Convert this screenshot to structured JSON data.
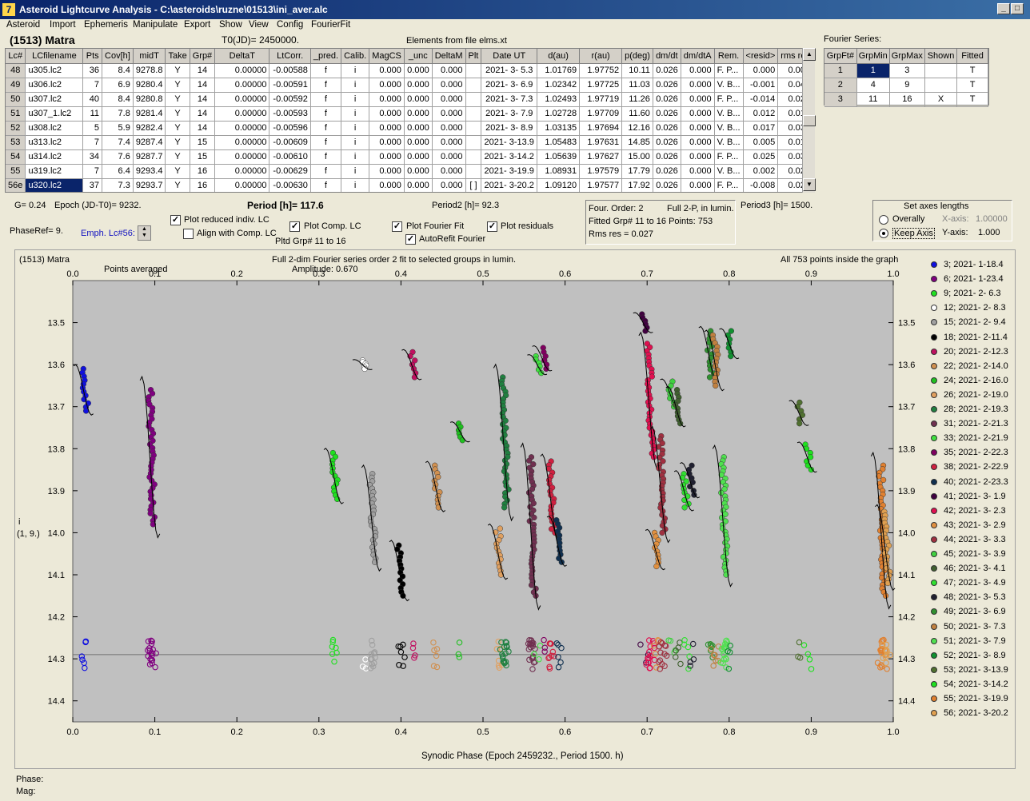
{
  "window": {
    "title": "Asteroid Lightcurve Analysis - C:\\asteroids\\ruzne\\01513\\ini_aver.alc"
  },
  "menu": [
    {
      "label": "Asteroid",
      "u": "A"
    },
    {
      "label": "Import",
      "u": "I"
    },
    {
      "label": "Ephemeris",
      "u": "E"
    },
    {
      "label": "Manipulate",
      "u": "M"
    },
    {
      "label": "Export",
      "u": "E"
    },
    {
      "label": "Show",
      "u": "S"
    },
    {
      "label": "View",
      "u": "V"
    },
    {
      "label": "Config",
      "u": "C"
    },
    {
      "label": "FourierFit",
      "u": "F"
    }
  ],
  "header": {
    "asteroid": "(1513) Matra",
    "t0": "T0(JD)= 2450000.",
    "elements": "Elements from file elms.xt"
  },
  "table": {
    "columns": [
      "Lc#",
      "LCfilename",
      "Pts",
      "Cov[h]",
      "midT",
      "Take",
      "Grp#",
      "DeltaT",
      "LtCorr.",
      "_pred.",
      "Calib.",
      "MagCS",
      "_unc",
      "DeltaM",
      "Plt",
      "Date UT",
      "d(au)",
      "r(au)",
      "p(deg)",
      "dm/dt",
      "dm/dtA",
      "Rem.",
      "<resid>",
      "rms res"
    ],
    "rows": [
      [
        "48",
        "u305.lc2",
        "36",
        "8.4",
        "9278.8",
        "Y",
        "14",
        "0.00000",
        "-0.00588",
        "f",
        "i",
        "0.000",
        "0.000",
        "0.000",
        "",
        "2021- 3- 5.3",
        "1.01769",
        "1.97752",
        "10.11",
        "0.026",
        "0.000",
        "F. P...",
        "0.000",
        "0.007"
      ],
      [
        "49",
        "u306.lc2",
        "7",
        "6.9",
        "9280.4",
        "Y",
        "14",
        "0.00000",
        "-0.00591",
        "f",
        "i",
        "0.000",
        "0.000",
        "0.000",
        "",
        "2021- 3- 6.9",
        "1.02342",
        "1.97725",
        "11.03",
        "0.026",
        "0.000",
        "V. B...",
        "-0.001",
        "0.048"
      ],
      [
        "50",
        "u307.lc2",
        "40",
        "8.4",
        "9280.8",
        "Y",
        "14",
        "0.00000",
        "-0.00592",
        "f",
        "i",
        "0.000",
        "0.000",
        "0.000",
        "",
        "2021- 3- 7.3",
        "1.02493",
        "1.97719",
        "11.26",
        "0.026",
        "0.000",
        "F. P...",
        "-0.014",
        "0.027"
      ],
      [
        "51",
        "u307_1.lc2",
        "11",
        "7.8",
        "9281.4",
        "Y",
        "14",
        "0.00000",
        "-0.00593",
        "f",
        "i",
        "0.000",
        "0.000",
        "0.000",
        "",
        "2021- 3- 7.9",
        "1.02728",
        "1.97709",
        "11.60",
        "0.026",
        "0.000",
        "V. B...",
        "0.012",
        "0.016"
      ],
      [
        "52",
        "u308.lc2",
        "5",
        "5.9",
        "9282.4",
        "Y",
        "14",
        "0.00000",
        "-0.00596",
        "f",
        "i",
        "0.000",
        "0.000",
        "0.000",
        "",
        "2021- 3- 8.9",
        "1.03135",
        "1.97694",
        "12.16",
        "0.026",
        "0.000",
        "V. B...",
        "0.017",
        "0.035"
      ],
      [
        "53",
        "u313.lc2",
        "7",
        "7.4",
        "9287.4",
        "Y",
        "15",
        "0.00000",
        "-0.00609",
        "f",
        "i",
        "0.000",
        "0.000",
        "0.000",
        "",
        "2021- 3-13.9",
        "1.05483",
        "1.97631",
        "14.85",
        "0.026",
        "0.000",
        "V. B...",
        "0.005",
        "0.014"
      ],
      [
        "54",
        "u314.lc2",
        "34",
        "7.6",
        "9287.7",
        "Y",
        "15",
        "0.00000",
        "-0.00610",
        "f",
        "i",
        "0.000",
        "0.000",
        "0.000",
        "",
        "2021- 3-14.2",
        "1.05639",
        "1.97627",
        "15.00",
        "0.026",
        "0.000",
        "F. P...",
        "0.025",
        "0.039"
      ],
      [
        "55",
        "u319.lc2",
        "7",
        "6.4",
        "9293.4",
        "Y",
        "16",
        "0.00000",
        "-0.00629",
        "f",
        "i",
        "0.000",
        "0.000",
        "0.000",
        "",
        "2021- 3-19.9",
        "1.08931",
        "1.97579",
        "17.79",
        "0.026",
        "0.000",
        "V. B...",
        "0.002",
        "0.021"
      ],
      [
        "56e",
        "u320.lc2",
        "37",
        "7.3",
        "9293.7",
        "Y",
        "16",
        "0.00000",
        "-0.00630",
        "f",
        "i",
        "0.000",
        "0.000",
        "0.000",
        "[ ]",
        "2021- 3-20.2",
        "1.09120",
        "1.97577",
        "17.92",
        "0.026",
        "0.000",
        "F. P...",
        "-0.008",
        "0.021"
      ]
    ]
  },
  "fourier": {
    "title": "Fourier Series:",
    "columns": [
      "GrpFt#",
      "GrpMin",
      "GrpMax",
      "Shown",
      "Fitted"
    ],
    "rows": [
      [
        "1",
        "1",
        "3",
        "",
        "T"
      ],
      [
        "2",
        "4",
        "9",
        "",
        "T"
      ],
      [
        "3",
        "11",
        "16",
        "X",
        "T"
      ]
    ]
  },
  "controls": {
    "g": "G= 0.24",
    "epoch": "Epoch (JD-T0)= 9232.",
    "period": "Period [h]= 117.6",
    "period2": "Period2 [h]= 92.3",
    "period3": "Period3 [h]= 1500.",
    "phaseref": "PhaseRef= 9.",
    "emph": "Emph. Lc#56:",
    "plot_reduced": "Plot reduced indiv. LC",
    "align_comp": "Align with Comp. LC",
    "plot_comp": "Plot Comp. LC",
    "plotted_grp": "Pltd Grp#  11 to   16",
    "plot_fourier": "Plot Fourier Fit",
    "autorefit": "AutoRefit Fourier",
    "plot_resid": "Plot residuals",
    "four_order": "Four. Order:  2",
    "full2p": "Full 2-P, in lumin.",
    "fitted": "Fitted Grp# 11 to 16 Points: 753",
    "rms": "Rms res     = 0.027",
    "axes_title": "Set axes lengths",
    "overally": "Overally",
    "keep_axis": "Keep Axis",
    "xaxis_label": "X-axis:",
    "xaxis_val": "1.00000",
    "yaxis_label": "Y-axis:",
    "yaxis_val": "1.000"
  },
  "plot": {
    "name": "(1513) Matra",
    "subtitle": "Full 2-dim Fourier series order 2 fit to selected groups in lumin.",
    "amplitude": "Amplitude: 0.670",
    "points_avg": "Points averaged",
    "inside": "All 753 points inside the graph",
    "xlabel": "Synodic Phase (Epoch 2459232., Period 1500. h)",
    "ylabel": "i",
    "ylabel2": "(1, 9.)",
    "phase": "Phase:",
    "mag": "Mag:"
  },
  "chart_data": {
    "type": "scatter",
    "xlim": [
      0,
      1
    ],
    "ylim": [
      13.4,
      14.45
    ],
    "xticks": [
      "0.0",
      "0.1",
      "0.2",
      "0.3",
      "0.4",
      "0.5",
      "0.6",
      "0.7",
      "0.8",
      "0.9",
      "1.0"
    ],
    "yticks": [
      "13.5",
      "13.6",
      "13.7",
      "13.8",
      "13.9",
      "14.0",
      "14.1",
      "14.2",
      "14.3",
      "14.4"
    ],
    "residual_zero": 14.29,
    "series": [
      {
        "name": "3; 2021- 1-18.4",
        "color": "#1010e0",
        "phase": 0.013,
        "mag": [
          13.61,
          13.71
        ]
      },
      {
        "name": "6; 2021- 1-23.4",
        "color": "#800080",
        "phase": 0.094,
        "mag": [
          13.66,
          13.98
        ]
      },
      {
        "name": "9; 2021- 2- 6.3",
        "color": "#20e020",
        "phase": 0.318,
        "mag": [
          13.81,
          13.92
        ]
      },
      {
        "name": "12; 2021- 2- 8.3",
        "color": "#ffffff",
        "phase": 0.353,
        "mag": [
          13.59,
          13.61
        ]
      },
      {
        "name": "15; 2021- 2- 9.4",
        "color": "#a0a0a0",
        "phase": 0.364,
        "mag": [
          13.86,
          14.07
        ]
      },
      {
        "name": "18; 2021- 2-11.4",
        "color": "#000000",
        "phase": 0.398,
        "mag": [
          14.03,
          14.15
        ]
      },
      {
        "name": "20; 2021- 2-12.3",
        "color": "#c01060",
        "phase": 0.413,
        "mag": [
          13.57,
          13.63
        ]
      },
      {
        "name": "22; 2021- 2-14.0",
        "color": "#d09050",
        "phase": 0.442,
        "mag": [
          13.84,
          13.94
        ]
      },
      {
        "name": "24; 2021- 2-16.0",
        "color": "#20c020",
        "phase": 0.472,
        "mag": [
          13.74,
          13.78
        ]
      },
      {
        "name": "26; 2021- 2-19.0",
        "color": "#e0a060",
        "phase": 0.518,
        "mag": [
          13.99,
          14.1
        ]
      },
      {
        "name": "28; 2021- 2-19.3",
        "color": "#208040",
        "phase": 0.525,
        "mag": [
          13.63,
          13.94
        ]
      },
      {
        "name": "31; 2021- 2-21.3",
        "color": "#703050",
        "phase": 0.558,
        "mag": [
          13.82,
          14.15
        ]
      },
      {
        "name": "33; 2021- 2-21.9",
        "color": "#40e040",
        "phase": 0.566,
        "mag": [
          13.58,
          13.62
        ]
      },
      {
        "name": "35; 2021- 2-22.3",
        "color": "#800060",
        "phase": 0.572,
        "mag": [
          13.56,
          13.61
        ]
      },
      {
        "name": "38; 2021- 2-22.9",
        "color": "#d02040",
        "phase": 0.582,
        "mag": [
          13.83,
          14.0
        ]
      },
      {
        "name": "40; 2021- 2-23.3",
        "color": "#103050",
        "phase": 0.59,
        "mag": [
          13.97,
          14.07
        ]
      },
      {
        "name": "41; 2021- 3- 1.9",
        "color": "#400040",
        "phase": 0.695,
        "mag": [
          13.48,
          13.52
        ]
      },
      {
        "name": "42; 2021- 3- 2.3",
        "color": "#e01050",
        "phase": 0.702,
        "mag": [
          13.55,
          13.82
        ]
      },
      {
        "name": "43; 2021- 3- 2.9",
        "color": "#e09040",
        "phase": 0.71,
        "mag": [
          14.0,
          14.08
        ]
      },
      {
        "name": "44; 2021- 3- 3.3",
        "color": "#a03040",
        "phase": 0.716,
        "mag": [
          13.77,
          14.0
        ]
      },
      {
        "name": "45; 2021- 3- 3.9",
        "color": "#40d040",
        "phase": 0.728,
        "mag": [
          13.64,
          13.7
        ]
      },
      {
        "name": "46; 2021- 3- 4.1",
        "color": "#406030",
        "phase": 0.735,
        "mag": [
          13.66,
          13.74
        ]
      },
      {
        "name": "47; 2021- 3- 4.9",
        "color": "#30e030",
        "phase": 0.745,
        "mag": [
          13.86,
          13.94
        ]
      },
      {
        "name": "48; 2021- 3- 5.3",
        "color": "#202030",
        "phase": 0.752,
        "mag": [
          13.84,
          13.91
        ]
      },
      {
        "name": "49; 2021- 3- 6.9",
        "color": "#309030",
        "phase": 0.775,
        "mag": [
          13.52,
          13.63
        ]
      },
      {
        "name": "50; 2021- 3- 7.3",
        "color": "#c08040",
        "phase": 0.782,
        "mag": [
          13.53,
          13.65
        ]
      },
      {
        "name": "51; 2021- 3- 7.9",
        "color": "#50e050",
        "phase": 0.792,
        "mag": [
          13.82,
          14.1
        ]
      },
      {
        "name": "52; 2021- 3- 8.9",
        "color": "#109030",
        "phase": 0.8,
        "mag": [
          13.52,
          13.58
        ]
      },
      {
        "name": "53; 2021- 3-13.9",
        "color": "#507030",
        "phase": 0.885,
        "mag": [
          13.69,
          13.74
        ]
      },
      {
        "name": "54; 2021- 3-14.2",
        "color": "#20e020",
        "phase": 0.895,
        "mag": [
          13.79,
          13.85
        ]
      },
      {
        "name": "55; 2021- 3-19.9",
        "color": "#e08030",
        "phase": 0.985,
        "mag": [
          13.84,
          14.15
        ]
      },
      {
        "name": "56; 2021- 3-20.2",
        "color": "#e0a050",
        "phase": 0.99,
        "mag": [
          13.95,
          14.12
        ]
      }
    ]
  }
}
